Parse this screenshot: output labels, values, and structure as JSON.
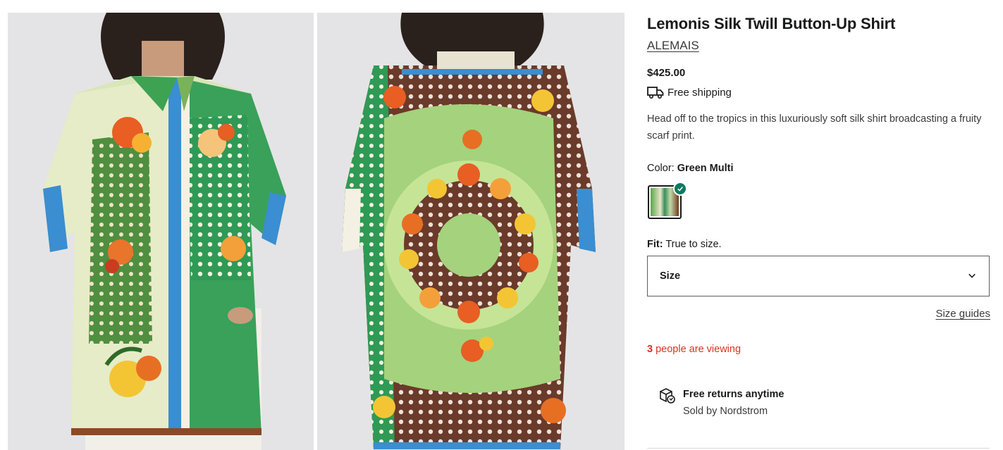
{
  "gallery": {
    "front_alt": "Front view of shirt",
    "back_alt": "Back view of shirt"
  },
  "product": {
    "title": "Lemonis Silk Twill Button-Up Shirt",
    "brand": "ALEMAIS",
    "price": "$425.00",
    "shipping": "Free shipping",
    "description": "Head off to the tropics in this luxuriously soft silk shirt broadcasting a fruity scarf print."
  },
  "color": {
    "label": "Color:",
    "value": "Green Multi"
  },
  "fit": {
    "label": "Fit:",
    "value": "True to size."
  },
  "size_select": {
    "label": "Size"
  },
  "size_guides": "Size guides",
  "viewing": {
    "count": "3",
    "text": " people are viewing"
  },
  "returns": {
    "title": "Free returns anytime",
    "subtitle": "Sold by Nordstrom"
  },
  "colors": {
    "accent_red": "#d6341e",
    "check_green": "#0d7a5f"
  }
}
